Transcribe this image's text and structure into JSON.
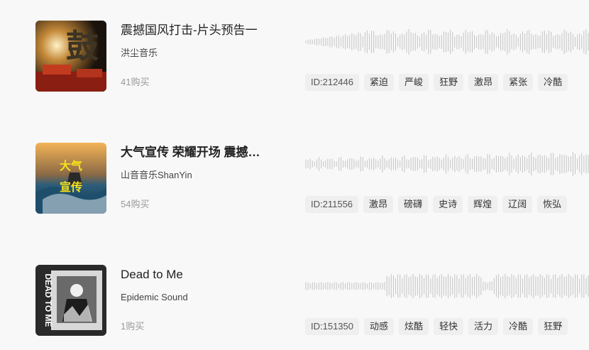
{
  "tracks": [
    {
      "title": "震撼国风打击-片头预告一",
      "artist": "洪尘音乐",
      "purchases": "41购买",
      "tags": [
        "ID:212446",
        "紧迫",
        "严峻",
        "狂野",
        "激昂",
        "紧张",
        "冷酷"
      ],
      "cover": {
        "text": "鼓",
        "theme": "drum"
      }
    },
    {
      "title": "大气宣传 荣耀开场 震撼…",
      "artist": "山音音乐ShanYin",
      "purchases": "54购买",
      "tags": [
        "ID:211556",
        "激昂",
        "磅礴",
        "史诗",
        "辉煌",
        "辽阔",
        "恢弘"
      ],
      "cover": {
        "text_top": "大气",
        "text_bottom": "宣传",
        "theme": "ship"
      }
    },
    {
      "title": "Dead to Me",
      "artist": "Epidemic Sound",
      "purchases": "1购买",
      "tags": [
        "ID:151350",
        "动感",
        "炫酷",
        "轻快",
        "活力",
        "冷酷",
        "狂野"
      ],
      "cover": {
        "text": "DEAD TO ME",
        "theme": "bw"
      }
    }
  ],
  "colors": {
    "waveform": "#c4c4c4",
    "tag_bg": "#efefef",
    "background": "#f8f8f8"
  }
}
